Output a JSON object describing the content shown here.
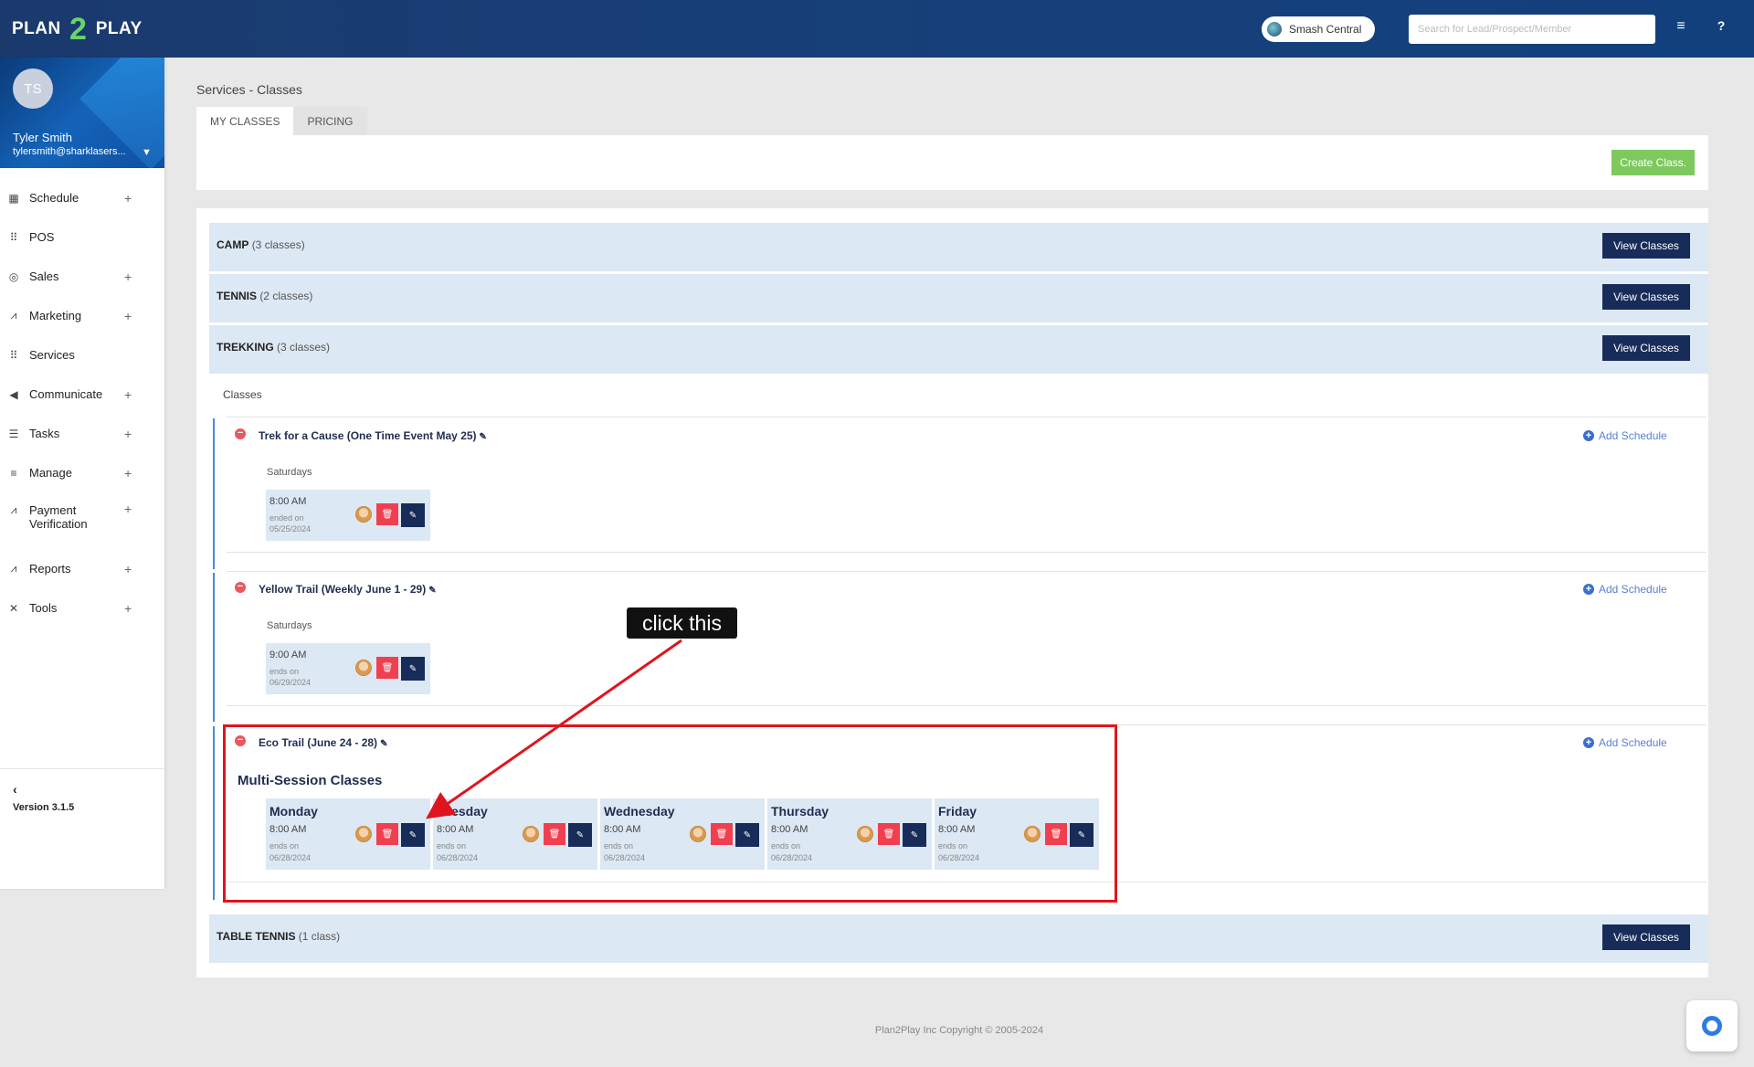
{
  "header": {
    "logo_left": "PLAN",
    "logo_mid": "2",
    "logo_right": "PLAY",
    "location": "Smash Central",
    "search_placeholder": "Search for Lead/Prospect/Member",
    "menu_icon": "hamburger-icon",
    "help_icon": "question-icon"
  },
  "profile": {
    "initials": "TS",
    "name": "Tyler Smith",
    "email": "tylersmith@sharklasers..."
  },
  "sidebar": {
    "items": [
      {
        "label": "Schedule",
        "icon": "calendar-icon",
        "expand": "+"
      },
      {
        "label": "POS",
        "icon": "grid-icon",
        "expand": ""
      },
      {
        "label": "Sales",
        "icon": "target-icon",
        "expand": "+"
      },
      {
        "label": "Marketing",
        "icon": "chart-icon",
        "expand": "+"
      },
      {
        "label": "Services",
        "icon": "grid-icon",
        "expand": ""
      },
      {
        "label": "Communicate",
        "icon": "megaphone-icon",
        "expand": "+"
      },
      {
        "label": "Tasks",
        "icon": "list-icon",
        "expand": "+"
      },
      {
        "label": "Manage",
        "icon": "bars-icon",
        "expand": "+"
      },
      {
        "label": "Payment",
        "label2": "Verification",
        "icon": "chart-icon",
        "expand": "+"
      },
      {
        "label": "Reports",
        "icon": "chart-icon",
        "expand": "+"
      },
      {
        "label": "Tools",
        "icon": "tools-icon",
        "expand": "+"
      }
    ],
    "back_glyph": "‹",
    "version": "Version 3.1.5"
  },
  "page": {
    "breadcrumb": "Services - Classes",
    "tabs": [
      "MY CLASSES",
      "PRICING"
    ],
    "create_button": "Create Class."
  },
  "categories": [
    {
      "name": "CAMP",
      "count": "(3 classes)",
      "button": "View Classes"
    },
    {
      "name": "TENNIS",
      "count": "(2 classes)",
      "button": "View Classes"
    },
    {
      "name": "TREKKING",
      "count": "(3 classes)",
      "button": "View Classes"
    },
    {
      "name": "TABLE TENNIS",
      "count": "(1 class)",
      "button": "View Classes"
    }
  ],
  "classes_label": "Classes",
  "add_schedule": "Add Schedule",
  "classes": [
    {
      "name": "Trek for a Cause (One Time Event May 25)",
      "day": "Saturdays",
      "time": "8:00 AM",
      "end_label": "ended on",
      "end_date": "05/25/2024"
    },
    {
      "name": "Yellow Trail (Weekly June 1 - 29)",
      "day": "Saturdays",
      "time": "9:00 AM",
      "end_label": "ends on",
      "end_date": "06/29/2024"
    },
    {
      "name": "Eco Trail (June 24 - 28)"
    }
  ],
  "multi_session": {
    "title": "Multi-Session Classes",
    "days": [
      {
        "day": "Monday",
        "time": "8:00 AM",
        "end_label": "ends on",
        "end_date": "06/28/2024"
      },
      {
        "day": "Tuesday",
        "time": "8:00 AM",
        "end_label": "ends on",
        "end_date": "06/28/2024"
      },
      {
        "day": "Wednesday",
        "time": "8:00 AM",
        "end_label": "ends on",
        "end_date": "06/28/2024"
      },
      {
        "day": "Thursday",
        "time": "8:00 AM",
        "end_label": "ends on",
        "end_date": "06/28/2024"
      },
      {
        "day": "Friday",
        "time": "8:00 AM",
        "end_label": "ends on",
        "end_date": "06/28/2024"
      }
    ]
  },
  "annotation": {
    "callout": "click this",
    "color": "#e0141e"
  },
  "footer": "Plan2Play Inc Copyright © 2005-2024",
  "icons": {
    "delete": "🗑",
    "edit": "✎",
    "minus": "−",
    "plus": "+",
    "chevron": "⌄"
  }
}
